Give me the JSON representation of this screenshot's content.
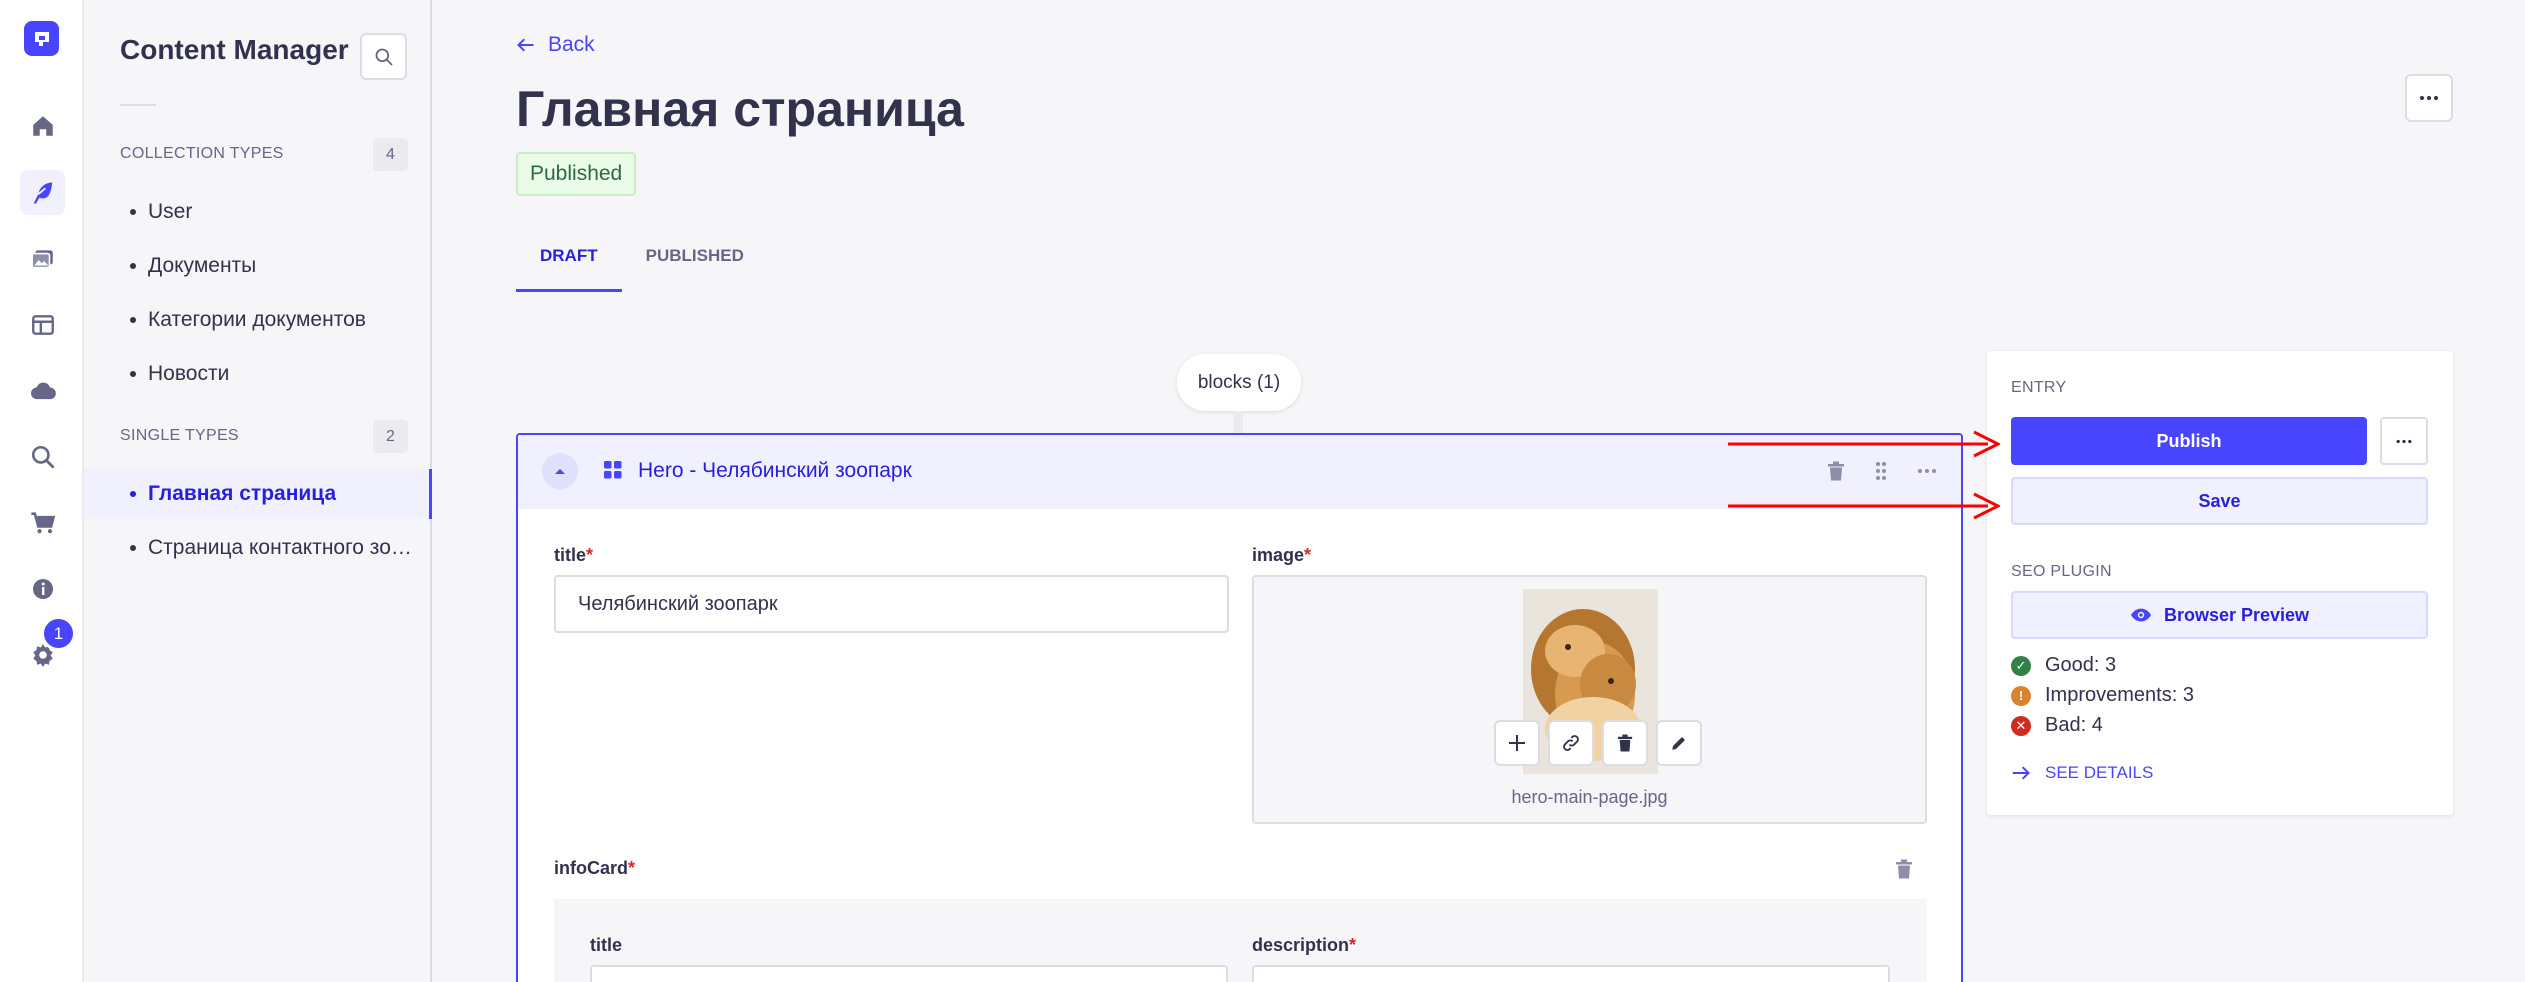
{
  "colors": {
    "primary": "#4945ff",
    "primary_dark": "#271fe0",
    "success": "#328048",
    "warning": "#d9822f",
    "danger": "#d02b20",
    "annotation_arrow": "#ff0000"
  },
  "rail": {
    "icons": [
      "logo-icon",
      "home-icon",
      "content-manager-icon",
      "media-library-icon",
      "content-type-builder-icon",
      "cloud-icon",
      "search-icon",
      "cart-icon",
      "info-icon",
      "settings-icon"
    ],
    "settings_badge": "1"
  },
  "content_manager": {
    "title": "Content Manager",
    "collection_types": {
      "label": "COLLECTION TYPES",
      "count": "4",
      "items": [
        "User",
        "Документы",
        "Категории документов",
        "Новости"
      ]
    },
    "single_types": {
      "label": "SINGLE TYPES",
      "count": "2",
      "items": [
        "Главная страница",
        "Страница контактного зоопарка"
      ]
    }
  },
  "header": {
    "back_label": "Back",
    "title": "Главная страница",
    "status_badge": "Published"
  },
  "tabs": [
    "DRAFT",
    "PUBLISHED"
  ],
  "dynamic_zone": {
    "label": "blocks (1)"
  },
  "component": {
    "title": "Hero - Челябинский зоопарк",
    "fields": {
      "title_label": "title",
      "title_value": "Челябинский зоопарк",
      "image_label": "image",
      "image_filename": "hero-main-page.jpg",
      "infocard_label": "infoCard",
      "infocard_title_label": "title",
      "infocard_description_label": "description"
    }
  },
  "panel": {
    "entry_label": "ENTRY",
    "publish_label": "Publish",
    "save_label": "Save",
    "seo_label": "SEO PLUGIN",
    "preview_label": "Browser Preview",
    "good": "Good: 3",
    "improvements": "Improvements: 3",
    "bad": "Bad: 4",
    "see_details": "SEE DETAILS"
  }
}
